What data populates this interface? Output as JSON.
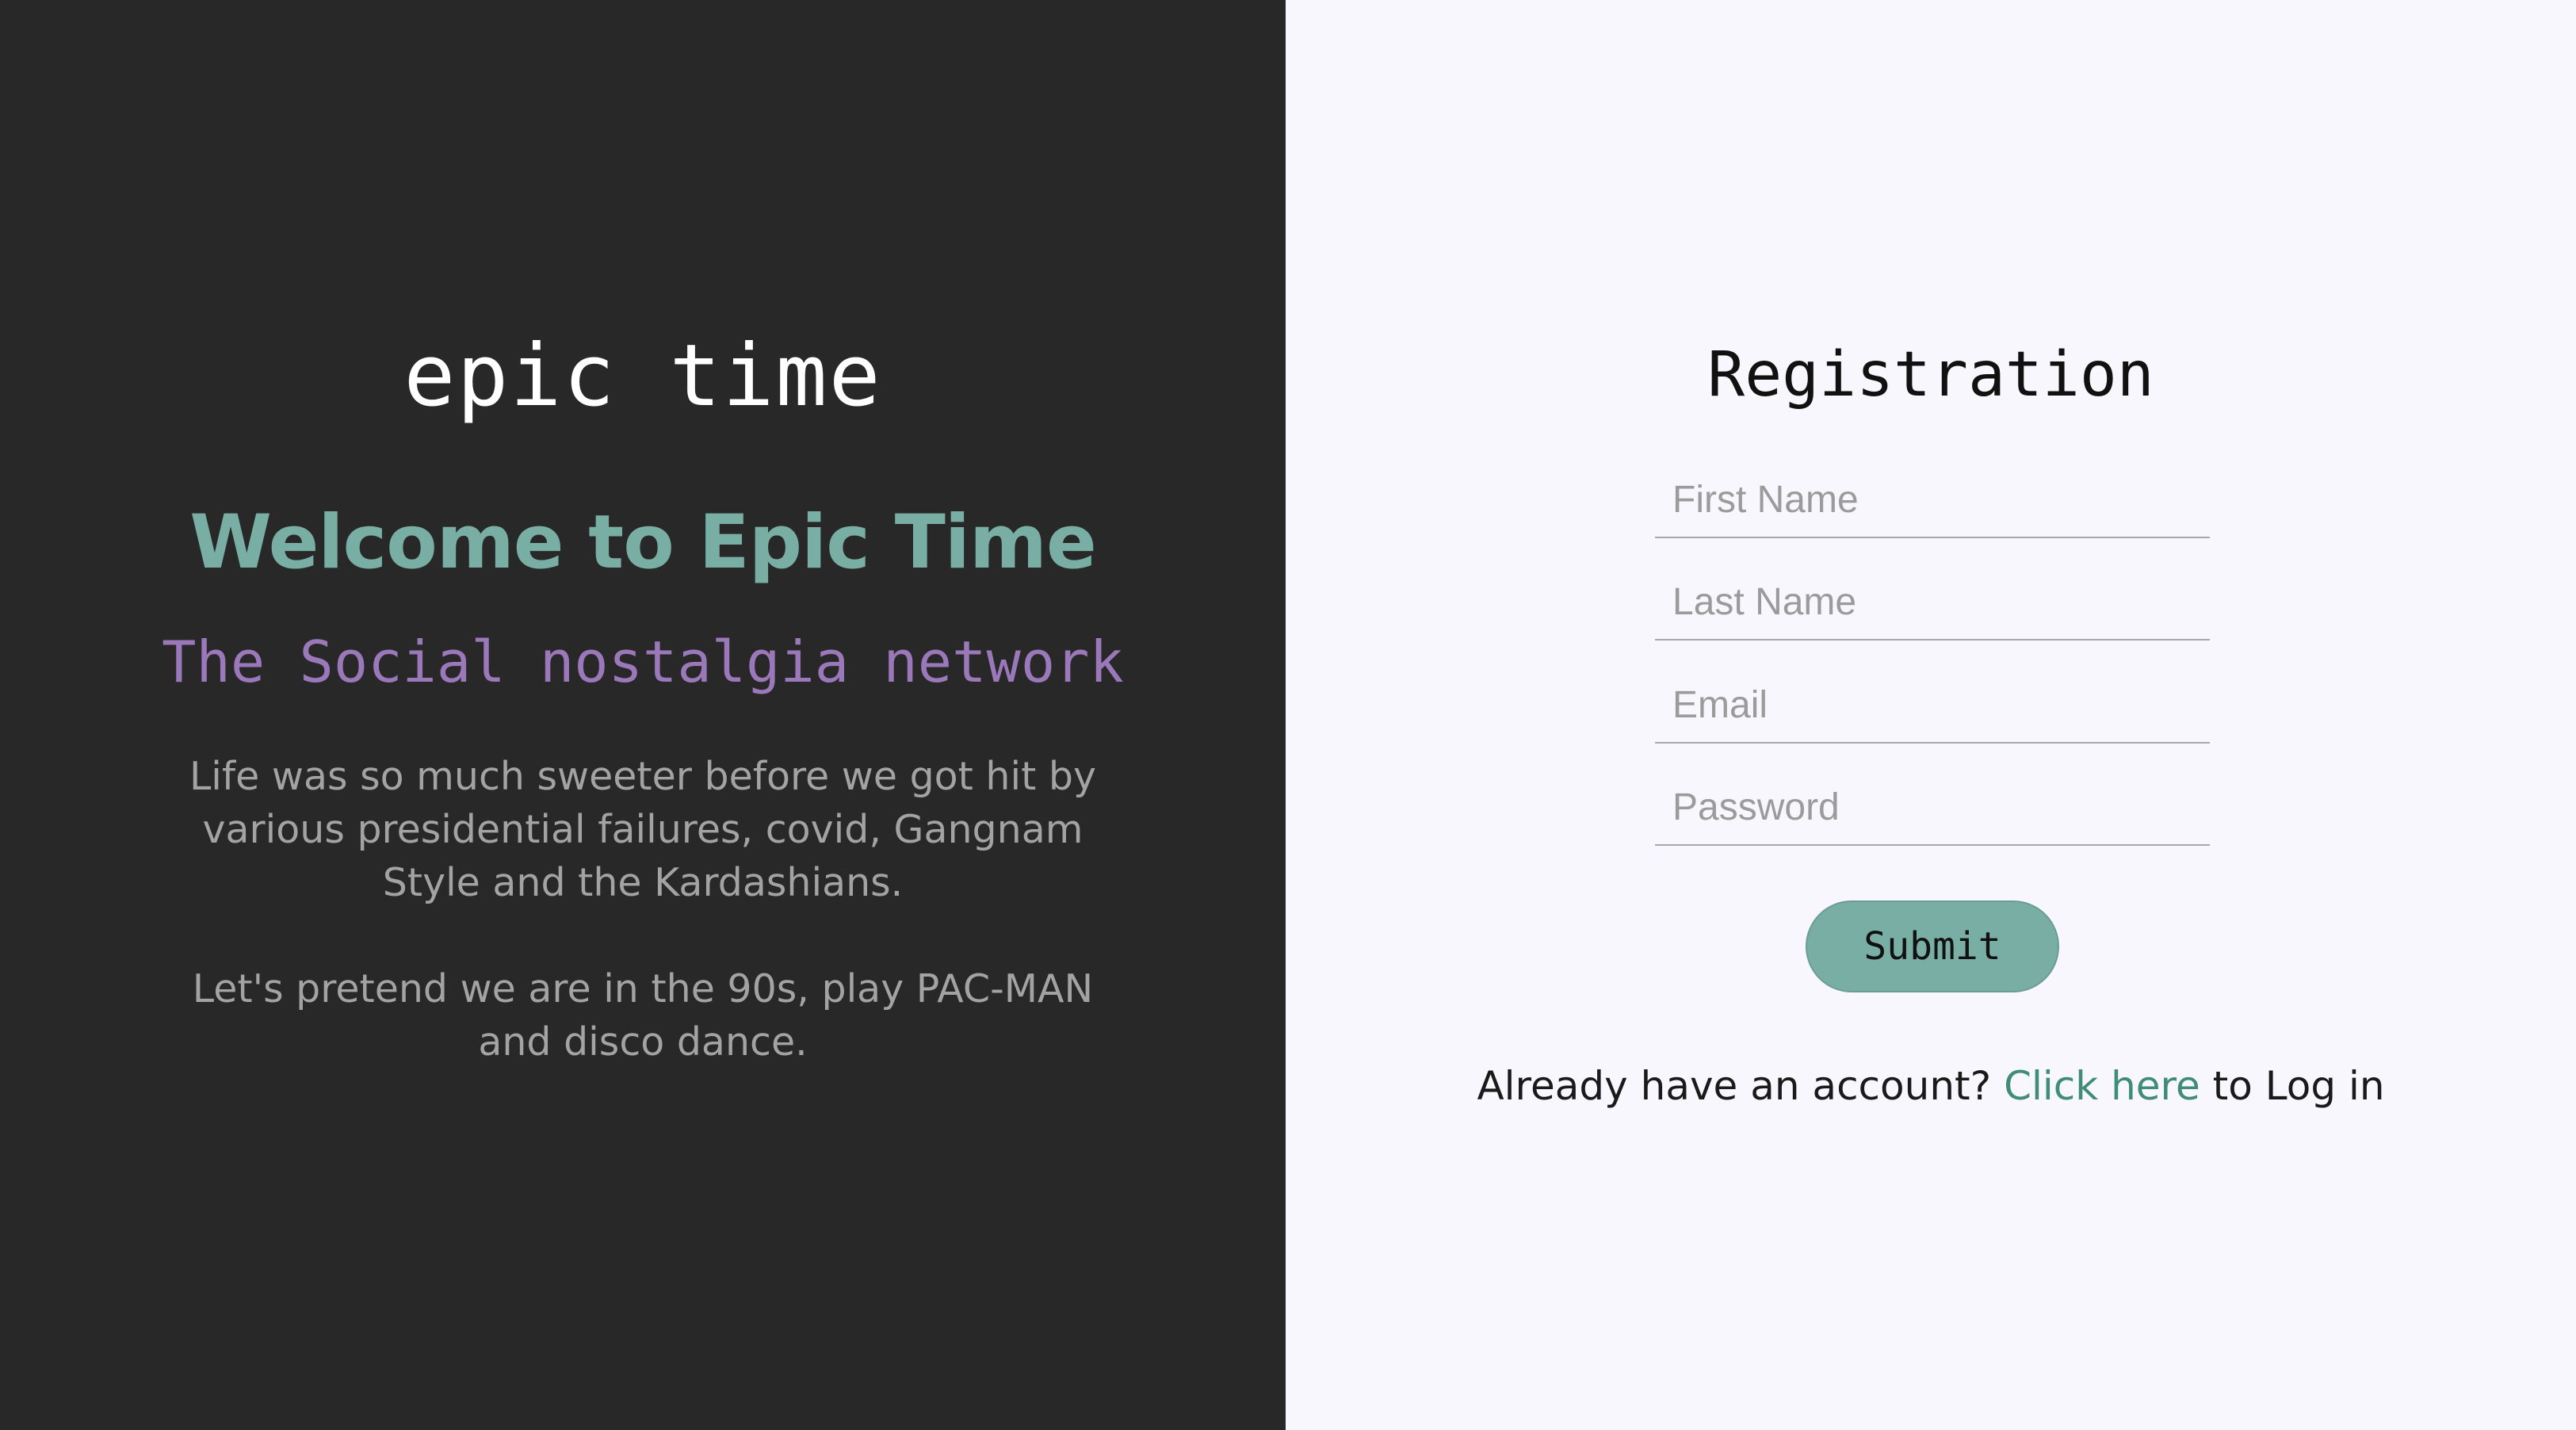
{
  "brand": {
    "logo_text": "epic time",
    "welcome_heading": "Welcome to Epic Time",
    "tagline": "The Social nostalgia network",
    "description_1": "Life was so much sweeter before we got hit by various presidential failures, covid, Gangnam Style and the Kardashians.",
    "description_2": "Let's pretend we are in the 90s, play PAC-MAN and disco dance."
  },
  "form": {
    "title": "Registration",
    "first_name_placeholder": "First Name",
    "last_name_placeholder": "Last Name",
    "email_placeholder": "Email",
    "password_placeholder": "Password",
    "submit_label": "Submit"
  },
  "login": {
    "prefix": "Already have an account? ",
    "link_text": "Click here",
    "suffix": " to Log in"
  },
  "colors": {
    "left_background": "#282828",
    "right_background": "#f8f7fd",
    "accent_teal": "#78aea3",
    "accent_purple": "#9a78ba",
    "link_green": "#3f8c78"
  }
}
